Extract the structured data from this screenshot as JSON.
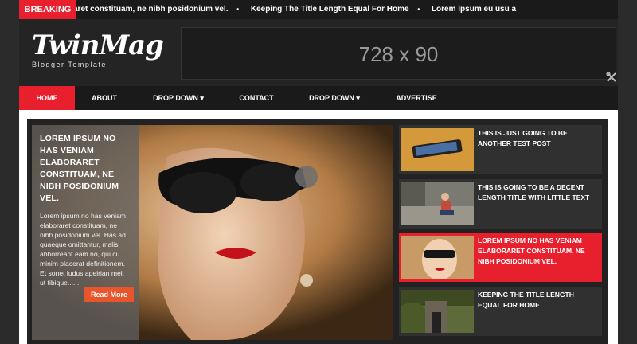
{
  "breaking": {
    "label": "BREAKING",
    "items": [
      "oraret constituam, ne nibh posidonium vel.",
      "Keeping The Title Length Equal For Home",
      "Lorem ipsum eu usu a"
    ],
    "separator": "•"
  },
  "logo": {
    "title": "TwinMag",
    "subtitle": "Blogger Template"
  },
  "ad": {
    "text": "728 x 90"
  },
  "nav": {
    "items": [
      {
        "label": "HOME"
      },
      {
        "label": "ABOUT"
      },
      {
        "label": "DROP DOWN ▾"
      },
      {
        "label": "CONTACT"
      },
      {
        "label": "DROP DOWN ▾"
      },
      {
        "label": "ADVERTISE"
      }
    ]
  },
  "featured": {
    "title": "LOREM IPSUM NO HAS VENIAM ELABORARET CONSTITUAM, NE NIBH POSIDONIUM VEL.",
    "excerpt": "Lorem ipsum no has veniam elaboraret constituam, ne nibh posidonium vel. Has ad quaeque omittantur, malis abhorreant eam no, qui cu minim placerat definitionem. Et sonet ludus apeirian mei, ut tibique......",
    "read_more": "Read More"
  },
  "side_posts": [
    {
      "title": "THIS IS JUST GOING TO BE ANOTHER TEST POST"
    },
    {
      "title": "THIS IS GOING TO BE A DECENT LENGTH TITLE WITH LITTLE TEXT"
    },
    {
      "title": "LOREM IPSUM NO HAS VENIAM ELABORARET CONSTITUAM, NE NIBH POSIDONIUM VEL."
    },
    {
      "title": "KEEPING THE TITLE LENGTH EQUAL FOR HOME"
    }
  ],
  "colors": {
    "accent": "#e8202e",
    "read_more": "#e8552a",
    "background": "#2b2b2b"
  },
  "icons": {
    "header_tool": "wrench-screwdriver-icon"
  }
}
